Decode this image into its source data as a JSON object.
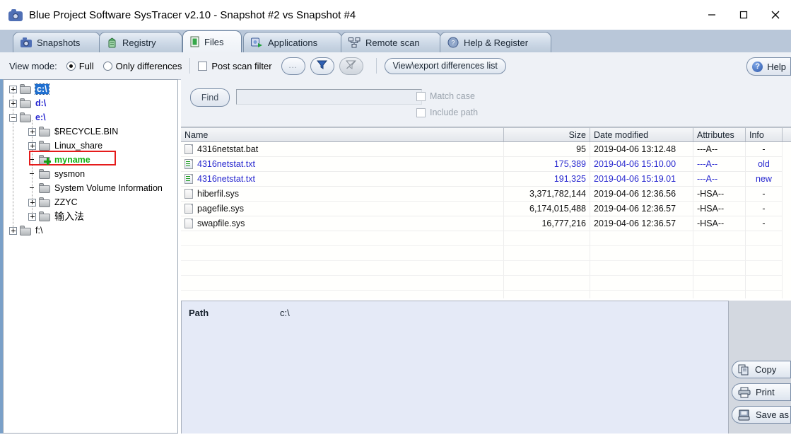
{
  "window": {
    "title": "Blue Project Software SysTracer v2.10 - Snapshot #2 vs Snapshot #4",
    "icon": "camera-icon",
    "minimize_label": "—",
    "maximize_label": "□",
    "close_label": "✕"
  },
  "tabs": [
    {
      "label": "Snapshots",
      "icon": "camera-icon",
      "active": false
    },
    {
      "label": "Registry",
      "icon": "registry-icon",
      "active": false
    },
    {
      "label": "Files",
      "icon": "file-icon",
      "active": true
    },
    {
      "label": "Applications",
      "icon": "apps-icon",
      "active": false
    },
    {
      "label": "Remote scan",
      "icon": "network-icon",
      "active": false
    },
    {
      "label": "Help & Register",
      "icon": "help-icon",
      "active": false
    }
  ],
  "toolbar": {
    "view_mode_label": "View mode:",
    "radio_full": "Full",
    "radio_only_differences": "Only differences",
    "radio_selected": "Full",
    "post_scan_filter_label": "Post scan filter",
    "post_scan_filter_checked": false,
    "ellipsis_button": "...",
    "filter_button": "filter-icon",
    "clear_filter_button": "clear-filter-icon",
    "differences_list_button": "View\\export differences list",
    "help_button": "Help"
  },
  "tree": {
    "nodes": [
      {
        "label": "c:\\",
        "indent": 0,
        "expander": "plus",
        "style": "drive-selected"
      },
      {
        "label": "d:\\",
        "indent": 0,
        "expander": "plus",
        "style": "drive"
      },
      {
        "label": "e:\\",
        "indent": 0,
        "expander": "minus",
        "style": "drive"
      },
      {
        "label": "$RECYCLE.BIN",
        "indent": 1,
        "expander": "plus",
        "style": "normal"
      },
      {
        "label": "Linux_share",
        "indent": 1,
        "expander": "plus",
        "style": "normal"
      },
      {
        "label": "myname",
        "indent": 1,
        "expander": "none",
        "style": "green-added"
      },
      {
        "label": "sysmon",
        "indent": 1,
        "expander": "none",
        "style": "normal"
      },
      {
        "label": "System Volume Information",
        "indent": 1,
        "expander": "none",
        "style": "normal"
      },
      {
        "label": "ZZYC",
        "indent": 1,
        "expander": "plus",
        "style": "normal"
      },
      {
        "label": "输入法",
        "indent": 1,
        "expander": "plus",
        "style": "normal"
      },
      {
        "label": "f:\\",
        "indent": 0,
        "expander": "plus",
        "style": "normal"
      }
    ]
  },
  "find": {
    "button_label": "Find",
    "input_value": "",
    "match_case_label": "Match case",
    "match_case_checked": false,
    "include_path_label": "Include path",
    "include_path_checked": false
  },
  "file_list": {
    "columns": [
      "Name",
      "Size",
      "Date modified",
      "Attributes",
      "Info"
    ],
    "rows": [
      {
        "name": "4316netstat.bat",
        "size": "95",
        "date": "2019-04-06 13:12.48",
        "attributes": "---A--",
        "info": "-",
        "icon": "file-icon",
        "changed": false
      },
      {
        "name": "4316netstat.txt",
        "size": "175,389",
        "date": "2019-04-06 15:10.00",
        "attributes": "---A--",
        "info": "old",
        "icon": "text-file-icon",
        "changed": true
      },
      {
        "name": "4316netstat.txt",
        "size": "191,325",
        "date": "2019-04-06 15:19.01",
        "attributes": "---A--",
        "info": "new",
        "icon": "text-file-icon",
        "changed": true
      },
      {
        "name": "hiberfil.sys",
        "size": "3,371,782,144",
        "date": "2019-04-06 12:36.56",
        "attributes": "-HSA--",
        "info": "-",
        "icon": "file-icon",
        "changed": false
      },
      {
        "name": "pagefile.sys",
        "size": "6,174,015,488",
        "date": "2019-04-06 12:36.57",
        "attributes": "-HSA--",
        "info": "-",
        "icon": "file-icon",
        "changed": false
      },
      {
        "name": "swapfile.sys",
        "size": "16,777,216",
        "date": "2019-04-06 12:36.57",
        "attributes": "-HSA--",
        "info": "-",
        "icon": "file-icon",
        "changed": false
      }
    ]
  },
  "detail": {
    "path_label": "Path",
    "path_value": "c:\\"
  },
  "side_buttons": [
    {
      "label": "Copy",
      "icon": "copy-icon"
    },
    {
      "label": "Print",
      "icon": "print-icon"
    },
    {
      "label": "Save as",
      "icon": "save-icon"
    }
  ],
  "colors": {
    "accent": "#4f6fb5",
    "tab_strip": "#b9c7d9",
    "changed_row": "#2a2ad0",
    "added_item": "#12b012",
    "annotation": "#e51b1b",
    "selection": "#1f6fd0"
  }
}
